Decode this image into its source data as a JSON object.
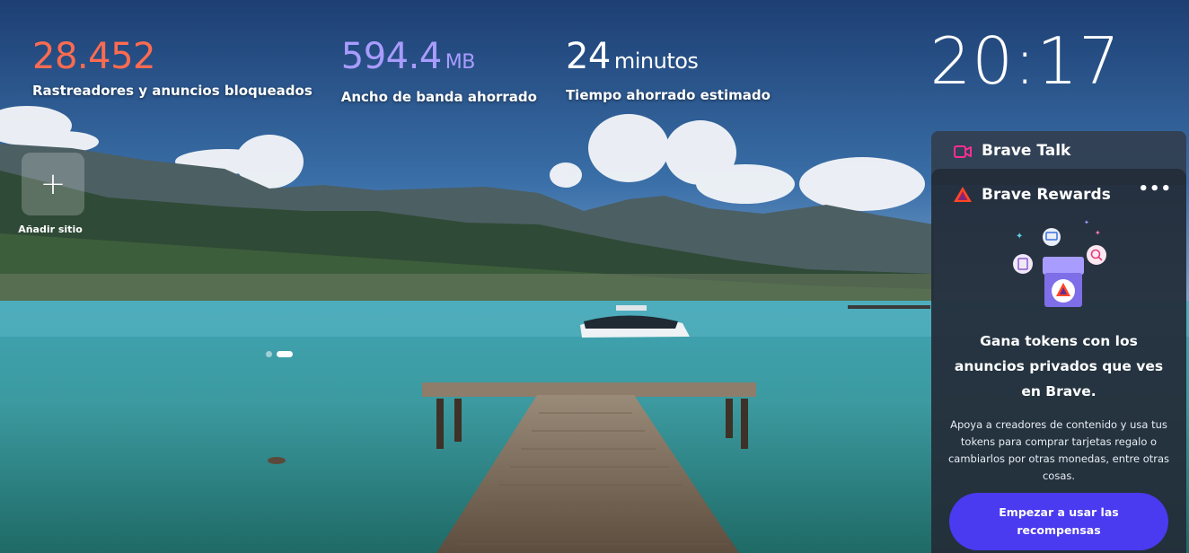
{
  "stats": {
    "trackers": {
      "value": "28.452",
      "caption": "Rastreadores y anuncios bloqueados"
    },
    "bandwidth": {
      "value": "594.4",
      "unit": "MB",
      "caption": "Ancho de banda ahorrado"
    },
    "time": {
      "value": "24",
      "unit": "minutos",
      "caption": "Tiempo ahorrado estimado"
    }
  },
  "clock": {
    "time": "20:17"
  },
  "top_sites": {
    "add_label": "Añadir sitio",
    "add_icon": "plus-icon"
  },
  "carousel": {
    "dots": 2,
    "active_index": 1
  },
  "talk": {
    "title": "Brave Talk",
    "icon": "video-camera-icon"
  },
  "rewards": {
    "title": "Brave Rewards",
    "icon": "bat-logo-icon",
    "menu_icon": "more-horizontal-icon",
    "headline": "Gana tokens con los anuncios privados que ves en Brave.",
    "body": "Apoya a creadores de contenido y usa tus tokens para comprar tarjetas regalo o cambiarlos por otras monedas, entre otras cosas.",
    "cta": "Empezar a usar las recompensas"
  },
  "colors": {
    "trackers": "#ff6b50",
    "bandwidth": "#a99cff",
    "cta": "#4a3af0",
    "talk_icon": "#ff2e93"
  }
}
